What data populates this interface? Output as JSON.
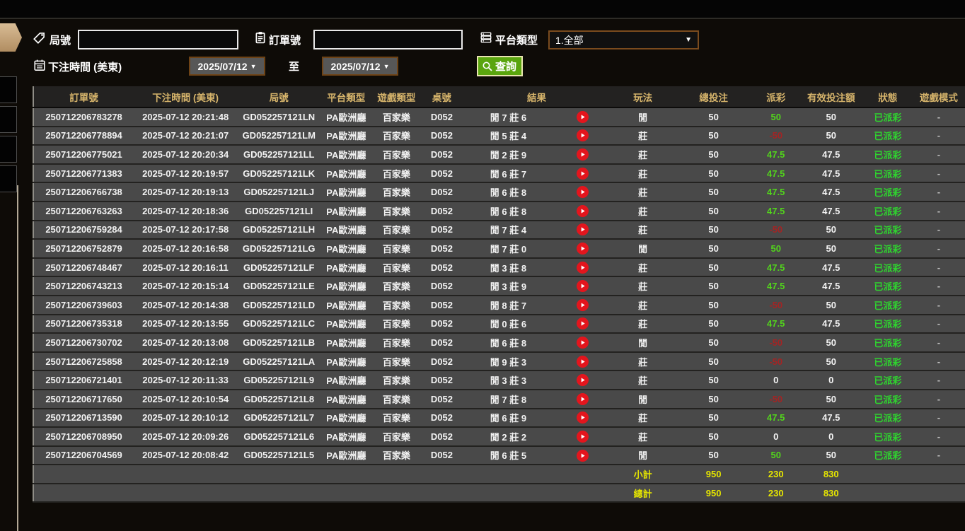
{
  "filters": {
    "game_no_label": "局號",
    "order_no_label": "訂單號",
    "platform_label": "平台類型",
    "platform_value": "1.全部",
    "bet_time_label": "下注時間 (美東)",
    "date_from": "2025/07/12",
    "to_label": "至",
    "date_to": "2025/07/12",
    "search_label": "查詢",
    "game_no_value": "",
    "order_no_value": ""
  },
  "colors": {
    "header_gold": "#d6b46b",
    "payout_positive": "#52d41c",
    "payout_negative": "#a32424",
    "status_green": "#2fd32f",
    "summary_yellow": "#e6e600",
    "search_button_green": "#5aa50e",
    "replay_red": "#e3151d"
  },
  "table": {
    "columns": [
      "訂單號",
      "下注時間 (美東)",
      "局號",
      "平台類型",
      "遊戲類型",
      "桌號",
      "結果",
      "玩法",
      "總投注",
      "派彩",
      "有效投注額",
      "狀態",
      "遊戲模式"
    ],
    "rows": [
      {
        "order": "250712206783278",
        "time": "2025-07-12 20:21:48",
        "round": "GD052257121LN",
        "platform": "PA歐洲廳",
        "game": "百家樂",
        "table": "D052",
        "result": "閒 7 莊 6",
        "play": "閒",
        "total": "50",
        "payout": "50",
        "valid": "50",
        "status": "已派彩",
        "mode": "-"
      },
      {
        "order": "250712206778894",
        "time": "2025-07-12 20:21:07",
        "round": "GD052257121LM",
        "platform": "PA歐洲廳",
        "game": "百家樂",
        "table": "D052",
        "result": "閒 5 莊 4",
        "play": "莊",
        "total": "50",
        "payout": "-50",
        "valid": "50",
        "status": "已派彩",
        "mode": "-"
      },
      {
        "order": "250712206775021",
        "time": "2025-07-12 20:20:34",
        "round": "GD052257121LL",
        "platform": "PA歐洲廳",
        "game": "百家樂",
        "table": "D052",
        "result": "閒 2 莊 9",
        "play": "莊",
        "total": "50",
        "payout": "47.5",
        "valid": "47.5",
        "status": "已派彩",
        "mode": "-"
      },
      {
        "order": "250712206771383",
        "time": "2025-07-12 20:19:57",
        "round": "GD052257121LK",
        "platform": "PA歐洲廳",
        "game": "百家樂",
        "table": "D052",
        "result": "閒 6 莊 7",
        "play": "莊",
        "total": "50",
        "payout": "47.5",
        "valid": "47.5",
        "status": "已派彩",
        "mode": "-"
      },
      {
        "order": "250712206766738",
        "time": "2025-07-12 20:19:13",
        "round": "GD052257121LJ",
        "platform": "PA歐洲廳",
        "game": "百家樂",
        "table": "D052",
        "result": "閒 6 莊 8",
        "play": "莊",
        "total": "50",
        "payout": "47.5",
        "valid": "47.5",
        "status": "已派彩",
        "mode": "-"
      },
      {
        "order": "250712206763263",
        "time": "2025-07-12 20:18:36",
        "round": "GD052257121LI",
        "platform": "PA歐洲廳",
        "game": "百家樂",
        "table": "D052",
        "result": "閒 6 莊 8",
        "play": "莊",
        "total": "50",
        "payout": "47.5",
        "valid": "47.5",
        "status": "已派彩",
        "mode": "-"
      },
      {
        "order": "250712206759284",
        "time": "2025-07-12 20:17:58",
        "round": "GD052257121LH",
        "platform": "PA歐洲廳",
        "game": "百家樂",
        "table": "D052",
        "result": "閒 7 莊 4",
        "play": "莊",
        "total": "50",
        "payout": "-50",
        "valid": "50",
        "status": "已派彩",
        "mode": "-"
      },
      {
        "order": "250712206752879",
        "time": "2025-07-12 20:16:58",
        "round": "GD052257121LG",
        "platform": "PA歐洲廳",
        "game": "百家樂",
        "table": "D052",
        "result": "閒 7 莊 0",
        "play": "閒",
        "total": "50",
        "payout": "50",
        "valid": "50",
        "status": "已派彩",
        "mode": "-"
      },
      {
        "order": "250712206748467",
        "time": "2025-07-12 20:16:11",
        "round": "GD052257121LF",
        "platform": "PA歐洲廳",
        "game": "百家樂",
        "table": "D052",
        "result": "閒 3 莊 8",
        "play": "莊",
        "total": "50",
        "payout": "47.5",
        "valid": "47.5",
        "status": "已派彩",
        "mode": "-"
      },
      {
        "order": "250712206743213",
        "time": "2025-07-12 20:15:14",
        "round": "GD052257121LE",
        "platform": "PA歐洲廳",
        "game": "百家樂",
        "table": "D052",
        "result": "閒 3 莊 9",
        "play": "莊",
        "total": "50",
        "payout": "47.5",
        "valid": "47.5",
        "status": "已派彩",
        "mode": "-"
      },
      {
        "order": "250712206739603",
        "time": "2025-07-12 20:14:38",
        "round": "GD052257121LD",
        "platform": "PA歐洲廳",
        "game": "百家樂",
        "table": "D052",
        "result": "閒 8 莊 7",
        "play": "莊",
        "total": "50",
        "payout": "-50",
        "valid": "50",
        "status": "已派彩",
        "mode": "-"
      },
      {
        "order": "250712206735318",
        "time": "2025-07-12 20:13:55",
        "round": "GD052257121LC",
        "platform": "PA歐洲廳",
        "game": "百家樂",
        "table": "D052",
        "result": "閒 0 莊 6",
        "play": "莊",
        "total": "50",
        "payout": "47.5",
        "valid": "47.5",
        "status": "已派彩",
        "mode": "-"
      },
      {
        "order": "250712206730702",
        "time": "2025-07-12 20:13:08",
        "round": "GD052257121LB",
        "platform": "PA歐洲廳",
        "game": "百家樂",
        "table": "D052",
        "result": "閒 6 莊 8",
        "play": "閒",
        "total": "50",
        "payout": "-50",
        "valid": "50",
        "status": "已派彩",
        "mode": "-"
      },
      {
        "order": "250712206725858",
        "time": "2025-07-12 20:12:19",
        "round": "GD052257121LA",
        "platform": "PA歐洲廳",
        "game": "百家樂",
        "table": "D052",
        "result": "閒 9 莊 3",
        "play": "莊",
        "total": "50",
        "payout": "-50",
        "valid": "50",
        "status": "已派彩",
        "mode": "-"
      },
      {
        "order": "250712206721401",
        "time": "2025-07-12 20:11:33",
        "round": "GD052257121L9",
        "platform": "PA歐洲廳",
        "game": "百家樂",
        "table": "D052",
        "result": "閒 3 莊 3",
        "play": "莊",
        "total": "50",
        "payout": "0",
        "valid": "0",
        "status": "已派彩",
        "mode": "-"
      },
      {
        "order": "250712206717650",
        "time": "2025-07-12 20:10:54",
        "round": "GD052257121L8",
        "platform": "PA歐洲廳",
        "game": "百家樂",
        "table": "D052",
        "result": "閒 7 莊 8",
        "play": "閒",
        "total": "50",
        "payout": "-50",
        "valid": "50",
        "status": "已派彩",
        "mode": "-"
      },
      {
        "order": "250712206713590",
        "time": "2025-07-12 20:10:12",
        "round": "GD052257121L7",
        "platform": "PA歐洲廳",
        "game": "百家樂",
        "table": "D052",
        "result": "閒 6 莊 9",
        "play": "莊",
        "total": "50",
        "payout": "47.5",
        "valid": "47.5",
        "status": "已派彩",
        "mode": "-"
      },
      {
        "order": "250712206708950",
        "time": "2025-07-12 20:09:26",
        "round": "GD052257121L6",
        "platform": "PA歐洲廳",
        "game": "百家樂",
        "table": "D052",
        "result": "閒 2 莊 2",
        "play": "莊",
        "total": "50",
        "payout": "0",
        "valid": "0",
        "status": "已派彩",
        "mode": "-"
      },
      {
        "order": "250712206704569",
        "time": "2025-07-12 20:08:42",
        "round": "GD052257121L5",
        "platform": "PA歐洲廳",
        "game": "百家樂",
        "table": "D052",
        "result": "閒 6 莊 5",
        "play": "閒",
        "total": "50",
        "payout": "50",
        "valid": "50",
        "status": "已派彩",
        "mode": "-"
      }
    ],
    "subtotal": {
      "label": "小計",
      "total": "950",
      "payout": "230",
      "valid": "830"
    },
    "grand_total": {
      "label": "總計",
      "total": "950",
      "payout": "230",
      "valid": "830"
    }
  }
}
